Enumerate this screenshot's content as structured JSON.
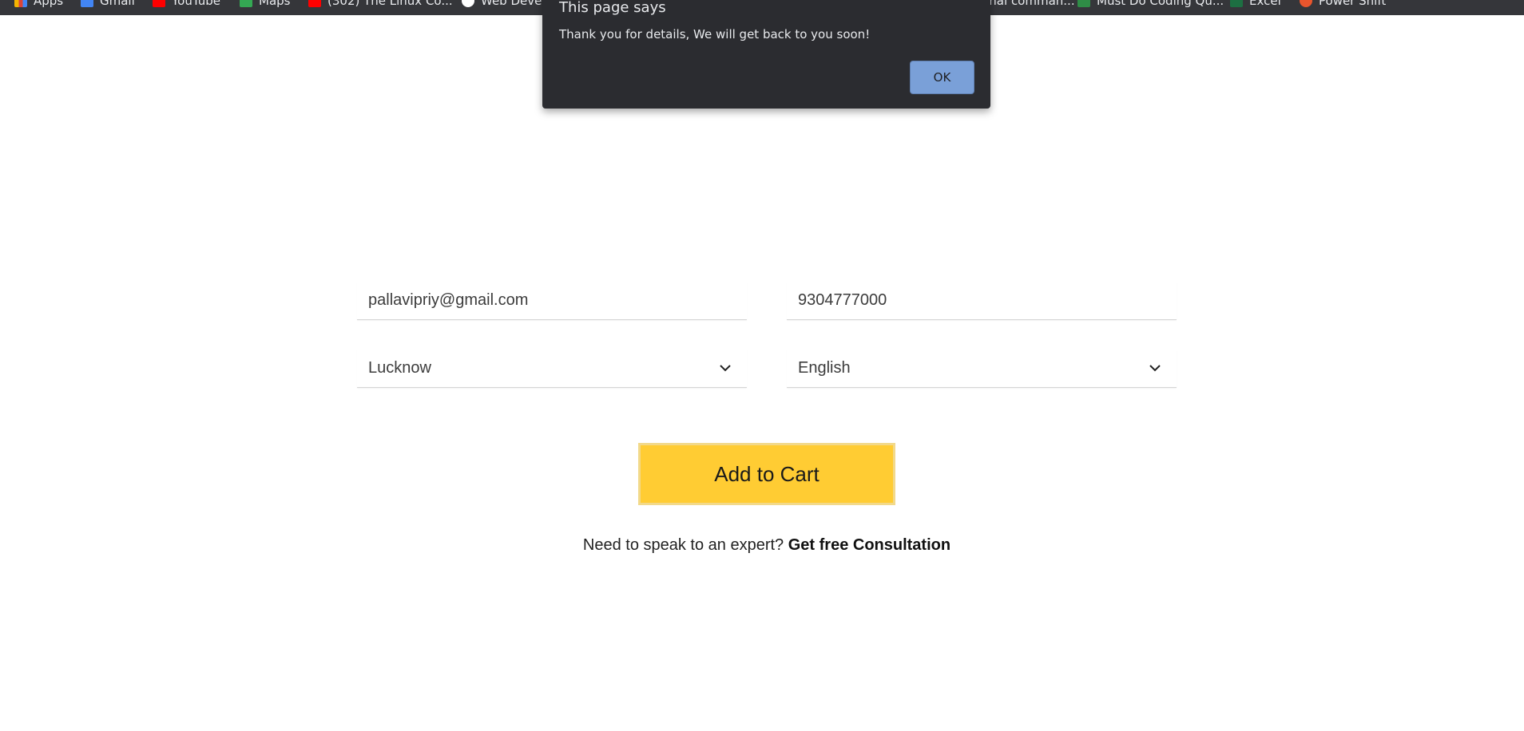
{
  "bookmarks": [
    {
      "label": "Apps",
      "icon": "apps-grid-icon",
      "color": "#f4b400"
    },
    {
      "label": "Gmail",
      "icon": "gmail-icon",
      "color": "#4285f4"
    },
    {
      "label": "YouTube",
      "icon": "youtube-icon",
      "color": "#ff0000"
    },
    {
      "label": "Maps",
      "icon": "maps-icon",
      "color": "#34a853"
    },
    {
      "label": "(302) The Linux Co...",
      "icon": "youtube-icon",
      "color": "#ff0000"
    },
    {
      "label": "Web Devel...",
      "icon": "globe-icon",
      "color": "#ffffff"
    },
    {
      "label": "...nal comman...",
      "icon": "page-icon",
      "color": "#9aa0a6"
    },
    {
      "label": "Must Do Coding Qu...",
      "icon": "gfg-icon",
      "color": "#2f8d46"
    },
    {
      "label": "Excel",
      "icon": "excel-icon",
      "color": "#1d6f42"
    },
    {
      "label": "Power Shift",
      "icon": "powershift-icon",
      "color": "#e8552d"
    }
  ],
  "dialog": {
    "title": "This page says",
    "message": "Thank you for details, We will get back to you soon!",
    "ok_label": "OK"
  },
  "form": {
    "email_value": "pallavipriy@gmail.com",
    "phone_value": "9304777000",
    "city_value": "Lucknow",
    "language_value": "English",
    "submit_label": "Add to Cart"
  },
  "consultation": {
    "prompt": "Need to speak to an expert?",
    "link_label": "Get free Consultation"
  },
  "colors": {
    "accent_yellow": "#ffcc33",
    "dialog_bg": "#2b2c30",
    "ok_button": "#7aa0d8"
  }
}
